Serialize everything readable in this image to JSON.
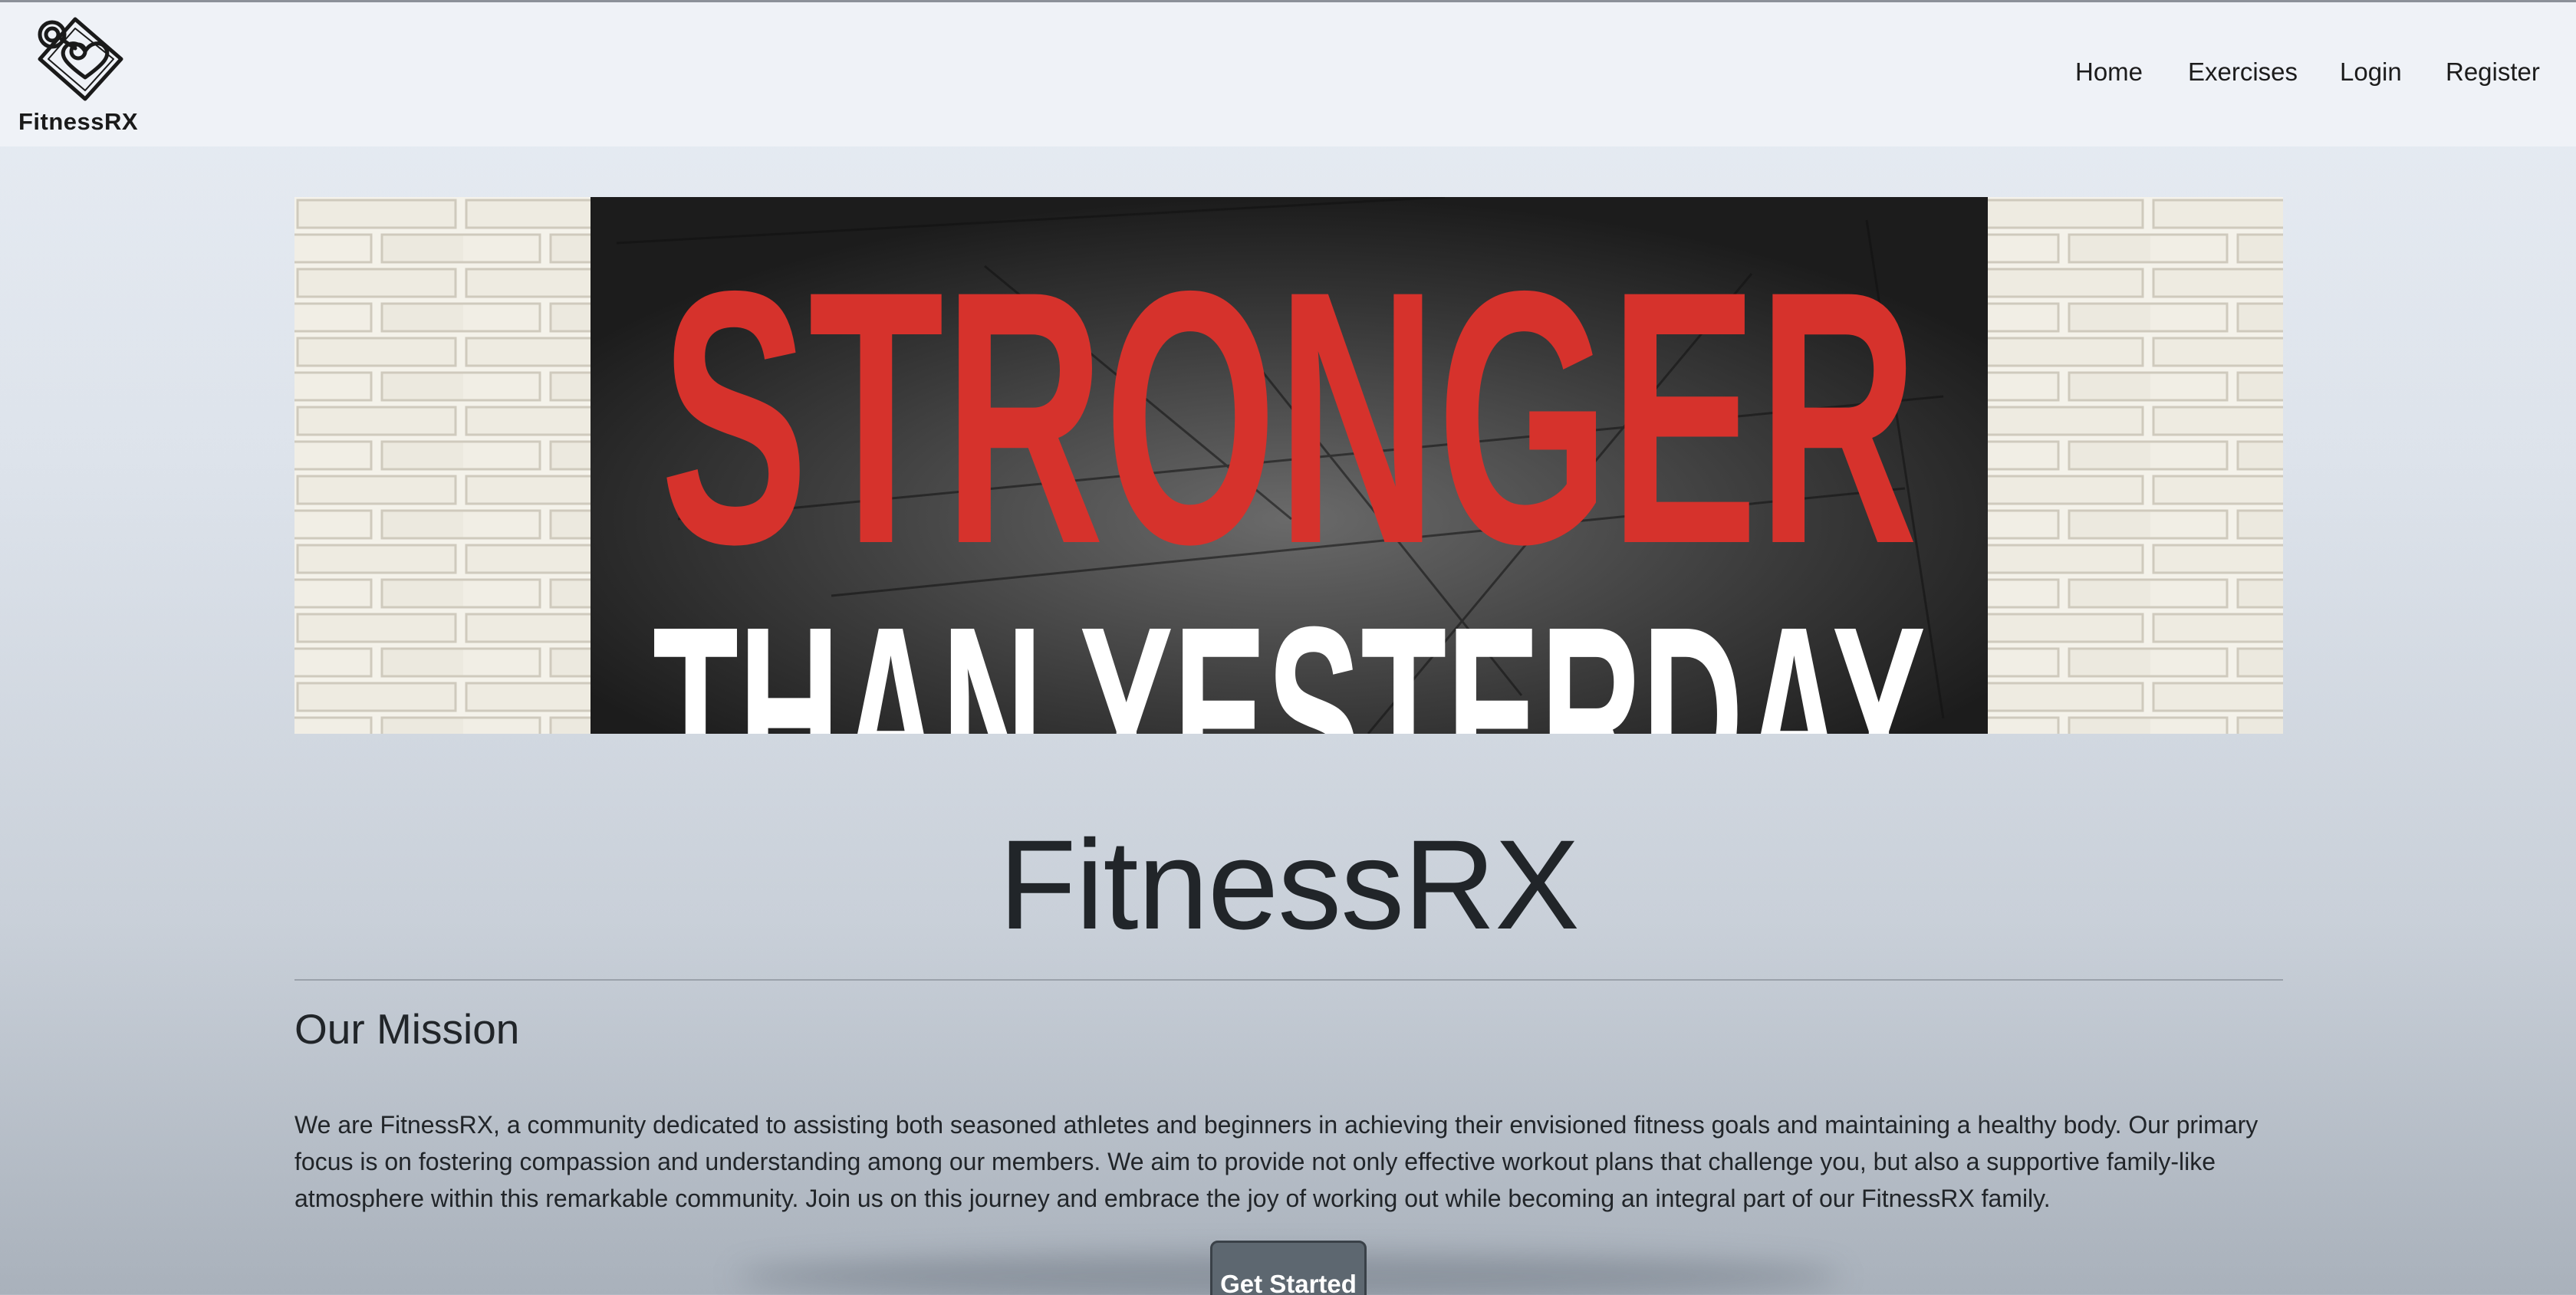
{
  "brand": {
    "name": "FitnessRX",
    "logo_icon": "dumbbell-heart-logo-icon"
  },
  "nav": {
    "items": [
      {
        "label": "Home"
      },
      {
        "label": "Exercises"
      },
      {
        "label": "Login"
      },
      {
        "label": "Register"
      }
    ]
  },
  "hero": {
    "line1": "STRONGER",
    "line2": "THAN YESTERDAY"
  },
  "main": {
    "title": "FitnessRX",
    "mission_heading": "Our Mission",
    "mission_text": "We are FitnessRX, a community dedicated to assisting both seasoned athletes and beginners in achieving their envisioned fitness goals and maintaining a healthy body. Our primary focus is on fostering compassion and understanding among our members. We aim to provide not only effective workout plans that challenge you, but also a supportive family-like atmosphere within this remarkable community. Join us on this journey and embrace the joy of working out while becoming an integral part of our FitnessRX family.",
    "cta_label": "Get Started"
  },
  "colors": {
    "hero_red": "#d6322c",
    "button": "#5d6770",
    "nav_bg": "#eff2f7"
  }
}
